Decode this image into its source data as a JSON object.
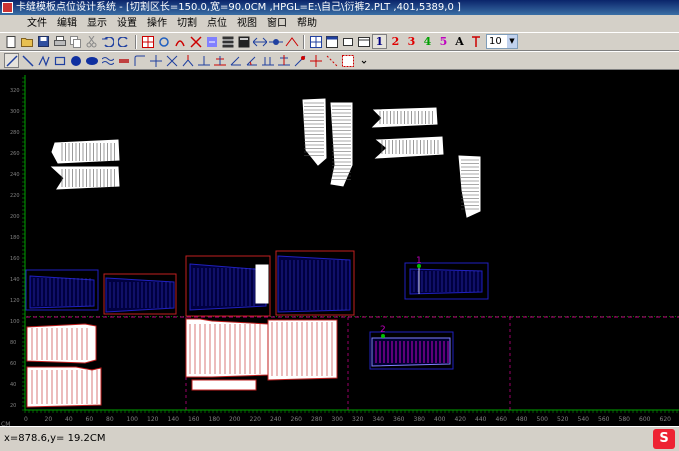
{
  "window": {
    "title": "卡缝模板点位设计系统 - [切割区长=150.0,宽=90.0CM ,HPGL=E:\\自己\\衍裤2.PLT ,401,5389,0 ]"
  },
  "menu": [
    "文件",
    "编辑",
    "显示",
    "设置",
    "操作",
    "切割",
    "点位",
    "视图",
    "窗口",
    "帮助"
  ],
  "toolbar1": {
    "icons": [
      "new-icon",
      "open-icon",
      "save-icon",
      "print-icon",
      "copy-icon",
      "cut-icon",
      "undo-icon",
      "redo-icon",
      "zoom-box-icon",
      "rotate-icon",
      "mirror-icon",
      "cut-tool-icon",
      "measure-icon",
      "grid-icon",
      "calc-icon",
      "move-icon",
      "align-icon",
      "group-icon",
      "layout-icon",
      "window-icon",
      "fit-icon"
    ],
    "layer_buttons": [
      {
        "label": "1",
        "color": "#000080"
      },
      {
        "label": "2",
        "color": "#e00000"
      },
      {
        "label": "3",
        "color": "#e00000"
      },
      {
        "label": "4",
        "color": "#00a000"
      },
      {
        "label": "5",
        "color": "#c000c0"
      }
    ],
    "text_button": "A",
    "size_value": "10"
  },
  "toolbar2": {
    "icons": [
      "pointer-icon",
      "line-icon",
      "polyline-icon",
      "rect-icon",
      "circle-icon",
      "ellipse-icon",
      "wave-icon",
      "fill-rect-icon",
      "corner-icon",
      "cross-icon",
      "xline-icon",
      "node-icon",
      "perpendicular-icon",
      "angle-icon",
      "offset-icon",
      "arc-icon",
      "parallel-icon",
      "mark-icon",
      "needle-icon",
      "pin-icon",
      "dots-icon",
      "grid-dot-icon",
      "more-icon"
    ]
  },
  "canvas": {
    "y_labels": [
      "320",
      "300",
      "280",
      "260",
      "240",
      "220",
      "200",
      "180",
      "160",
      "140",
      "120",
      "100",
      "80",
      "60",
      "40",
      "20"
    ],
    "x_labels": [
      "0",
      "20",
      "40",
      "60",
      "80",
      "100",
      "120",
      "140",
      "160",
      "180",
      "200",
      "220",
      "240",
      "260",
      "280",
      "300",
      "320",
      "340",
      "360",
      "380",
      "400",
      "420",
      "440",
      "460",
      "480",
      "500",
      "520",
      "540",
      "560",
      "580",
      "600",
      "620"
    ],
    "unit": "CM",
    "markers": [
      "1",
      "2"
    ]
  },
  "status": {
    "coords": "x=878.6,y= 19.2CM"
  },
  "colors": {
    "background": "#000000",
    "ruler": "#00a000",
    "blue_outline": "#2020c0",
    "red_outline": "#c02020",
    "magenta": "#c000c0",
    "piece_fill": "#ffffff"
  }
}
